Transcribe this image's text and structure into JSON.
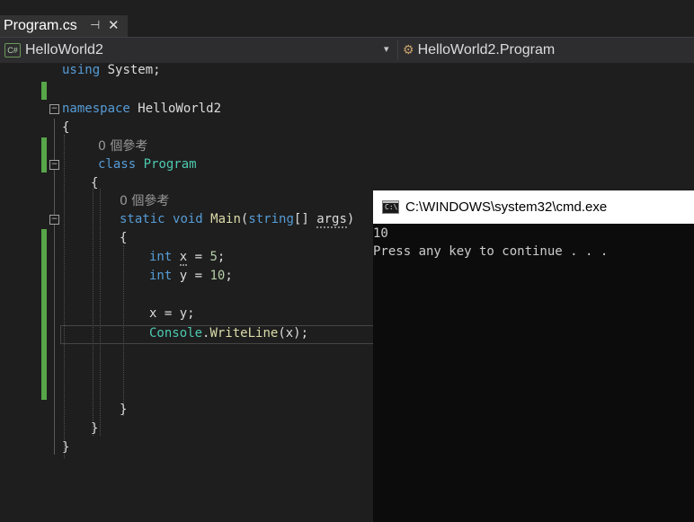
{
  "tab": {
    "title": "Program.cs",
    "pin_glyph": "⊣",
    "close_glyph": "✕"
  },
  "navbar": {
    "project": "HelloWorld2",
    "project_icon": "C#",
    "type": "HelloWorld2.Program",
    "dropdown_glyph": "▾"
  },
  "code": {
    "using_kw": "using",
    "using_ns": " System;",
    "namespace_kw": "namespace",
    "namespace_name": " HelloWorld2",
    "brace_open": "{",
    "brace_close": "}",
    "ref_count_class": "0 個參考",
    "class_kw": "class",
    "class_name": "Program",
    "ref_count_main": "0 個參考",
    "static_kw": "static",
    "void_kw": "void",
    "main_name": "Main",
    "string_kw": "string",
    "args_pre": "[] ",
    "args": "args",
    "paren_close": ")",
    "int_kw": "int",
    "var_x": "x",
    "var_y": "y",
    "assign_x_rest": " = ",
    "val_5": "5",
    "val_10": "10",
    "semi": ";",
    "stmt_assign": "x = y;",
    "console_type": "Console",
    "dot": ".",
    "writeline": "WriteLine",
    "writeline_args": "(x);"
  },
  "console": {
    "title": "C:\\WINDOWS\\system32\\cmd.exe",
    "output_line1": "10",
    "output_line2": "Press any key to continue . . ."
  }
}
